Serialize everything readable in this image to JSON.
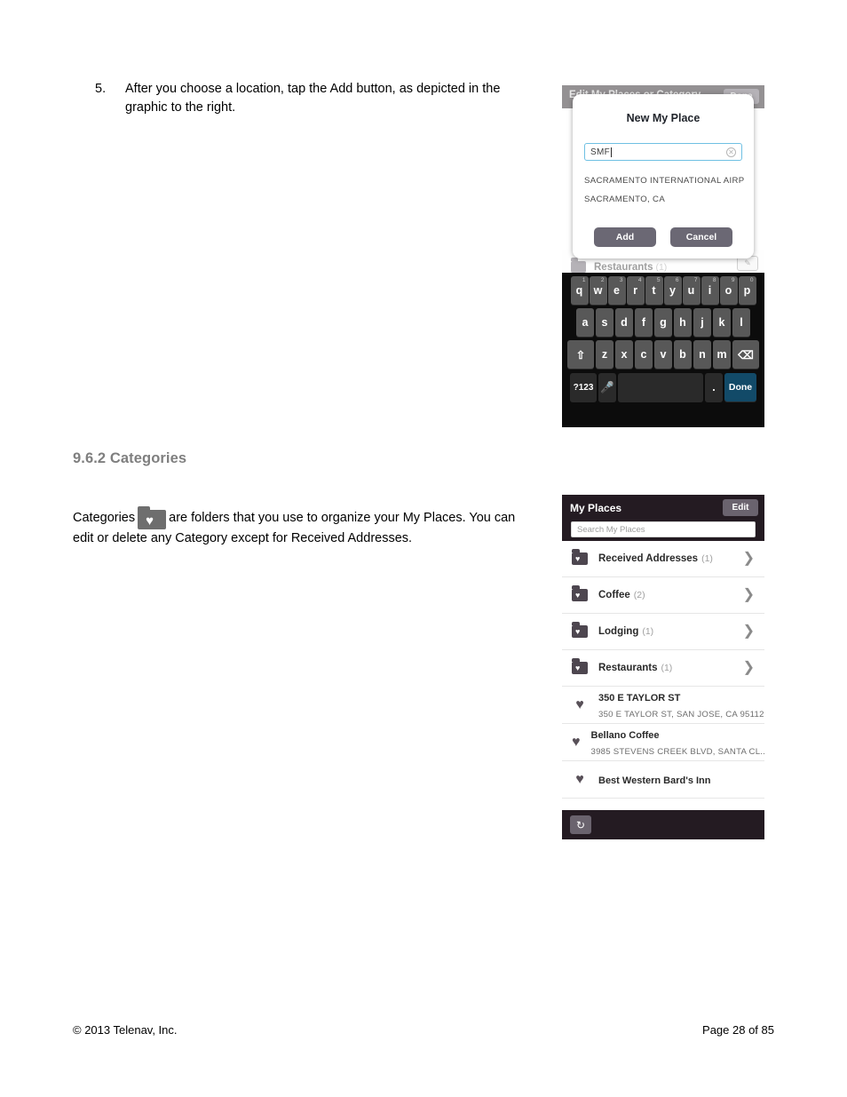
{
  "document": {
    "step": {
      "number": "5.",
      "text": "After you choose a location, tap the Add button, as depicted in the graphic to the right."
    },
    "section_heading": "9.6.2 Categories",
    "categories_paragraph_before": "Categories",
    "categories_paragraph_after": "are folders that you use to organize your My Places. You can edit or delete any Category except for Received Addresses.",
    "inline_folder_icon": "folder-heart-icon",
    "footer": {
      "copyright": "© 2013 Telenav, Inc.",
      "page": "Page 28 of 85"
    }
  },
  "screenshot_dialog": {
    "background_screen": {
      "header_title": "Edit My Places or Category",
      "header_done_label": "Done",
      "row_label": "Restaurants",
      "row_count": "(1)",
      "row_edit_icon": "pencil-icon"
    },
    "dialog": {
      "title": "New My Place",
      "input_value": "SMF",
      "input_placeholder": "",
      "clear_icon": "clear-circle-icon",
      "suggestions": [
        "SACRAMENTO INTERNATIONAL AIRPO...",
        "SACRAMENTO, CA"
      ],
      "add_label": "Add",
      "cancel_label": "Cancel"
    },
    "keyboard": {
      "row1": [
        {
          "key": "q",
          "sub": "1"
        },
        {
          "key": "w",
          "sub": "2"
        },
        {
          "key": "e",
          "sub": "3"
        },
        {
          "key": "r",
          "sub": "4"
        },
        {
          "key": "t",
          "sub": "5"
        },
        {
          "key": "y",
          "sub": "6"
        },
        {
          "key": "u",
          "sub": "7"
        },
        {
          "key": "i",
          "sub": "8"
        },
        {
          "key": "o",
          "sub": "9"
        },
        {
          "key": "p",
          "sub": "0"
        }
      ],
      "row2": [
        "a",
        "s",
        "d",
        "f",
        "g",
        "h",
        "j",
        "k",
        "l"
      ],
      "row3": {
        "shift_icon": "shift-up-arrow-icon",
        "keys": [
          "z",
          "x",
          "c",
          "v",
          "b",
          "n",
          "m"
        ],
        "backspace_icon": "backspace-icon"
      },
      "row4": {
        "symbols_label": "?123",
        "mic_icon": "microphone-icon",
        "space_label": "",
        "period_label": ".",
        "done_label": "Done"
      }
    }
  },
  "screenshot_places": {
    "header": {
      "title": "My Places",
      "edit_label": "Edit"
    },
    "search": {
      "placeholder": "Search My Places",
      "value": ""
    },
    "categories": [
      {
        "icon": "folder-heart-icon",
        "label": "Received Addresses",
        "count": "(1)",
        "chevron": "chevron-right-icon"
      },
      {
        "icon": "folder-heart-icon",
        "label": "Coffee",
        "count": "(2)",
        "chevron": "chevron-right-icon"
      },
      {
        "icon": "folder-heart-icon",
        "label": "Lodging",
        "count": "(1)",
        "chevron": "chevron-right-icon"
      },
      {
        "icon": "folder-heart-icon",
        "label": "Restaurants",
        "count": "(1)",
        "chevron": "chevron-right-icon"
      }
    ],
    "favorites": [
      {
        "icon": "heart-icon",
        "name": "350 E TAYLOR ST",
        "address": "350 E TAYLOR ST, SAN JOSE, CA 95112"
      },
      {
        "icon": "heart-icon",
        "name": "Bellano Coffee",
        "address": "3985 STEVENS CREEK BLVD, SANTA CL..."
      },
      {
        "icon": "heart-icon",
        "name": "Best Western Bard's Inn",
        "address": ""
      }
    ],
    "footer": {
      "refresh_icon": "refresh-icon"
    }
  },
  "colors": {
    "header_dark": "#241b22",
    "keyboard_bg": "#0c0c0c",
    "key_face": "#585858",
    "done_key": "#124a68",
    "dialog_button": "#6b6874",
    "heading_gray": "#7f7f7f",
    "input_focus_border": "#6fc0e3"
  }
}
